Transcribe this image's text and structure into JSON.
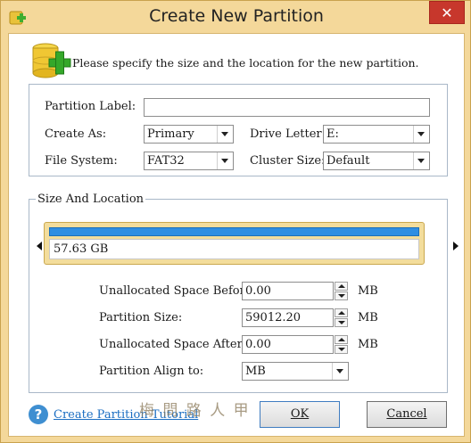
{
  "window": {
    "title": "Create New Partition",
    "close_label": "✕"
  },
  "header": {
    "description": "Please specify the size and the location for the new partition."
  },
  "form": {
    "partition_label": {
      "label": "Partition Label:",
      "value": ""
    },
    "create_as": {
      "label": "Create As:",
      "value": "Primary"
    },
    "drive_letter": {
      "label": "Drive Letter:",
      "value": "E:"
    },
    "file_system": {
      "label": "File System:",
      "value": "FAT32"
    },
    "cluster_size": {
      "label": "Cluster Size:",
      "value": "Default"
    }
  },
  "size_location": {
    "group_title": "Size And Location",
    "disk_size_label": "57.63 GB",
    "fill_fraction": 1.0,
    "unallocated_before": {
      "label": "Unallocated Space Before:",
      "value": "0.00",
      "unit": "MB"
    },
    "partition_size": {
      "label": "Partition Size:",
      "value": "59012.20",
      "unit": "MB"
    },
    "unallocated_after": {
      "label": "Unallocated Space After:",
      "value": "0.00",
      "unit": "MB"
    },
    "align_to": {
      "label": "Partition Align to:",
      "value": "MB"
    }
  },
  "footer": {
    "help_link": "Create Partition Tutorial",
    "watermark": "梅 問 路 人 甲",
    "ok_label": "OK",
    "cancel_label": "Cancel"
  },
  "colors": {
    "frame": "#f4d89a",
    "disk_fill": "#2f8ee2",
    "close_button": "#c7372c",
    "link": "#1b6ec2"
  }
}
